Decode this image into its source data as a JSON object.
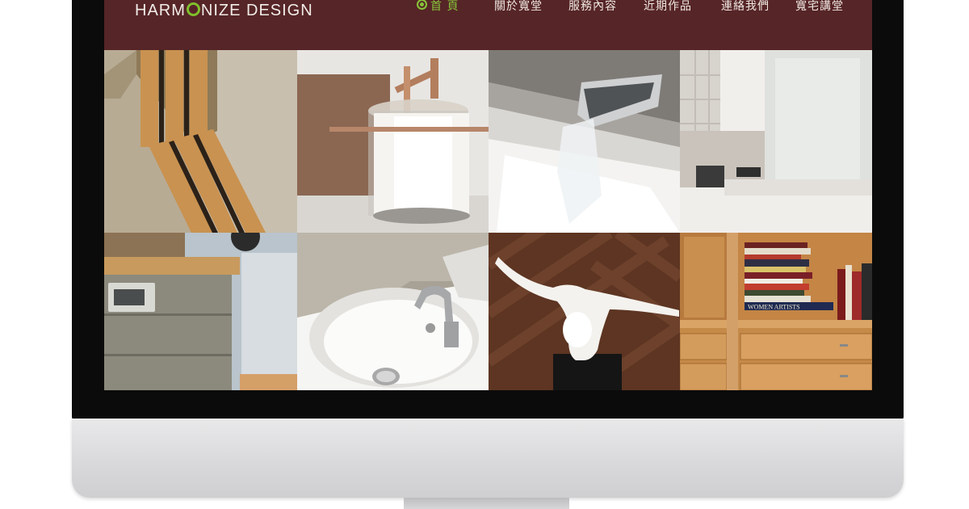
{
  "site": {
    "logo_part1": "HARM",
    "logo_part2": "NIZE DESIGN"
  },
  "nav": {
    "items": [
      {
        "label": "首 頁",
        "active": true
      },
      {
        "label": "關於寬堂"
      },
      {
        "label": "服務內容"
      },
      {
        "label": "近期作品"
      },
      {
        "label": "連絡我們"
      },
      {
        "label": "寬宅講堂"
      }
    ]
  },
  "gallery": {
    "tiles": [
      {
        "subject": "wood-slat-wall"
      },
      {
        "subject": "pendant-lamp"
      },
      {
        "subject": "waterfall-faucet"
      },
      {
        "subject": "white-cabinets"
      },
      {
        "subject": "stone-counter"
      },
      {
        "subject": "sink-faucet"
      },
      {
        "subject": "white-sculpture"
      },
      {
        "subject": "bookshelf"
      }
    ],
    "book_spine_text": "WOMEN ARTISTS"
  },
  "colors": {
    "header": "#562527",
    "accent": "#86c43a",
    "bezel": "#0b0b0b"
  }
}
